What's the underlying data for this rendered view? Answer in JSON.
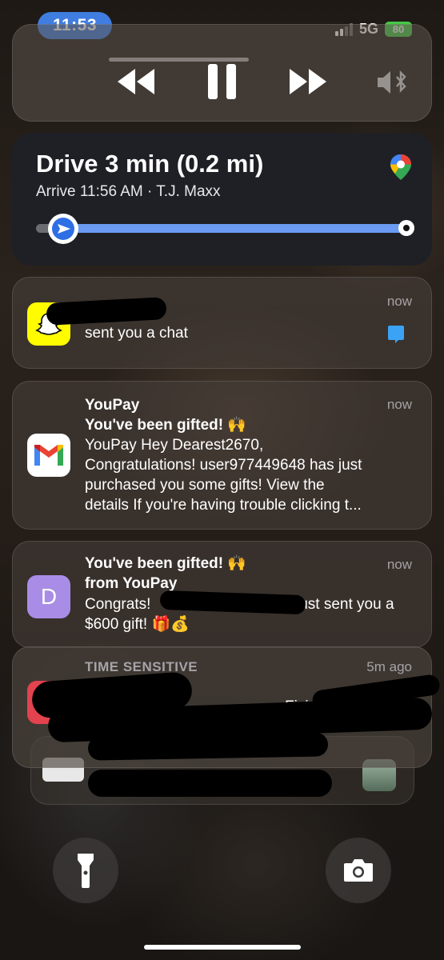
{
  "status_bar": {
    "time": "11:53",
    "network": "5G",
    "battery": "80"
  },
  "media": {
    "controls": [
      "rewind-icon",
      "pause-icon",
      "fast-forward-icon",
      "speaker-bluetooth-icon"
    ]
  },
  "navigation": {
    "title": "Drive 3 min (0.2 mi)",
    "subtitle": "Arrive 11:56 AM · T.J. Maxx",
    "progress": 0.06,
    "accent": "#6b9bf2"
  },
  "notifications": [
    {
      "app_icon": "snapchat-icon",
      "time": "now",
      "body": "sent you a chat"
    },
    {
      "app_icon": "gmail-icon",
      "time": "now",
      "title": "YouPay",
      "subject": "You've been gifted! 🙌",
      "body_lines": [
        "YouPay Hey Dearest2670,",
        "Congratulations! user977449648 has just",
        "purchased you some gifts! View the",
        "details If you're having trouble clicking t..."
      ]
    },
    {
      "app_icon": "letter-d-icon",
      "icon_letter": "D",
      "time": "now",
      "title": "You've been gifted! 🙌",
      "subtitle": "from YouPay",
      "body_start": "Congrats!",
      "body_end": "just sent you a",
      "body_line2": "$600 gift! 🎁💰"
    },
    {
      "label": "TIME SENSITIVE",
      "time": "5m ago",
      "fragment": "Fixing"
    }
  ],
  "bottom_controls": [
    "flashlight-icon",
    "camera-icon"
  ]
}
